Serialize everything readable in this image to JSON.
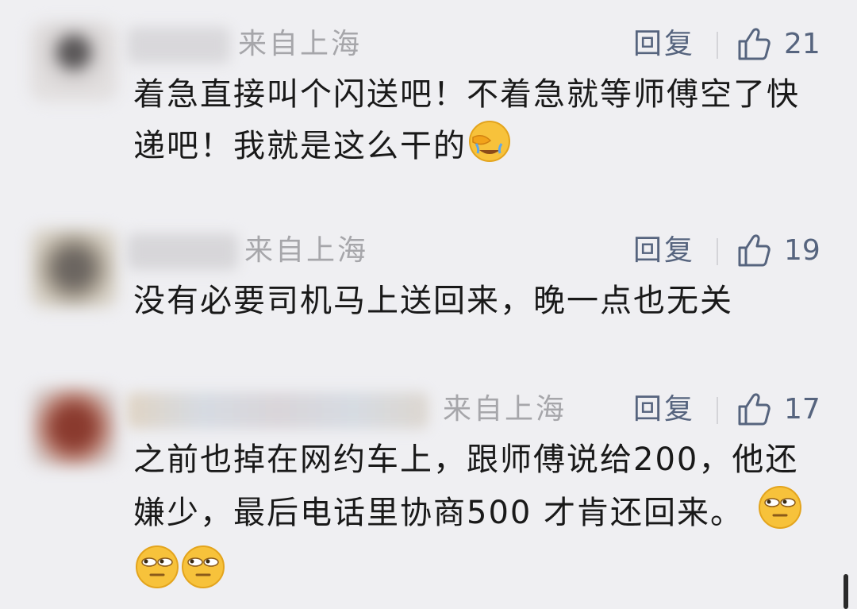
{
  "comments": [
    {
      "location": "来自上海",
      "reply_label": "回复",
      "like_count": "21",
      "text": "着急直接叫个闪送吧！不着急就等师傅空了快递吧！我就是这么干的",
      "emojis": [
        "facepalm-emoji"
      ]
    },
    {
      "location": "来自上海",
      "reply_label": "回复",
      "like_count": "19",
      "text": "没有必要司机马上送回来，晚一点也无关",
      "emojis": []
    },
    {
      "location": "来自上海",
      "reply_label": "回复",
      "like_count": "17",
      "text": "之前也掉在网约车上，跟师傅说给200，他还嫌少，最后电话里协商500 才肯还回来。",
      "emojis": [
        "eye-roll-emoji",
        "eye-roll-emoji",
        "eye-roll-emoji"
      ]
    }
  ],
  "icons": {
    "like": "thumbs-up-icon",
    "scroll": "scrollbar"
  },
  "colors": {
    "background": "#efeff2",
    "meta_gray": "#a6a6aa",
    "action_blue_gray": "#56647e",
    "body_text": "#191919"
  }
}
